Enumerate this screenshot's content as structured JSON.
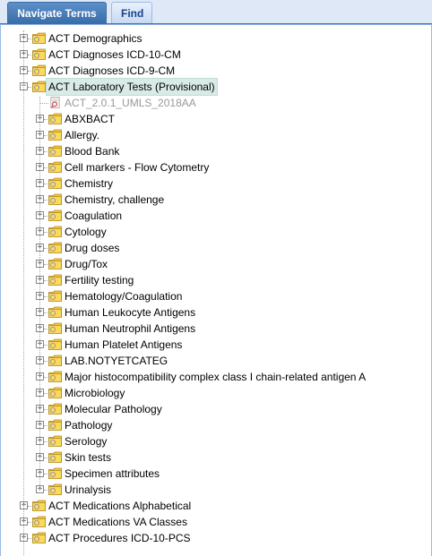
{
  "tabs": {
    "navigate_label": "Navigate Terms",
    "find_label": "Find"
  },
  "tree": {
    "top_before": [
      {
        "label": "ACT Demographics"
      },
      {
        "label": "ACT Diagnoses ICD-10-CM"
      },
      {
        "label": "ACT Diagnoses ICD-9-CM"
      }
    ],
    "expanded": {
      "label": "ACT Laboratory Tests (Provisional)",
      "selected": true,
      "leaf_label": "ACT_2.0.1_UMLS_2018AA",
      "children": [
        {
          "label": "ABXBACT"
        },
        {
          "label": "Allergy."
        },
        {
          "label": "Blood Bank"
        },
        {
          "label": "Cell markers - Flow Cytometry"
        },
        {
          "label": "Chemistry"
        },
        {
          "label": "Chemistry, challenge"
        },
        {
          "label": "Coagulation"
        },
        {
          "label": "Cytology"
        },
        {
          "label": "Drug doses"
        },
        {
          "label": "Drug/Tox"
        },
        {
          "label": "Fertility testing"
        },
        {
          "label": "Hematology/Coagulation"
        },
        {
          "label": "Human Leukocyte Antigens"
        },
        {
          "label": "Human Neutrophil Antigens"
        },
        {
          "label": "Human Platelet Antigens"
        },
        {
          "label": "LAB.NOTYETCATEG"
        },
        {
          "label": "Major histocompatibility complex class I chain-related antigen A"
        },
        {
          "label": "Microbiology"
        },
        {
          "label": "Molecular Pathology"
        },
        {
          "label": "Pathology"
        },
        {
          "label": "Serology"
        },
        {
          "label": "Skin tests"
        },
        {
          "label": "Specimen attributes"
        },
        {
          "label": "Urinalysis"
        }
      ]
    },
    "top_after": [
      {
        "label": "ACT Medications Alphabetical"
      },
      {
        "label": "ACT Medications VA Classes"
      },
      {
        "label": "ACT Procedures ICD-10-PCS"
      }
    ]
  },
  "colors": {
    "active_tab": "#3a6ea8",
    "panel_border": "#99bbe8",
    "selected_row": "#d8ebe6",
    "folder": "#f5c542"
  },
  "icons": {
    "expand": "plus-box-icon",
    "collapse": "minus-box-icon",
    "folder": "folder-icon",
    "leaf": "document-search-icon"
  }
}
